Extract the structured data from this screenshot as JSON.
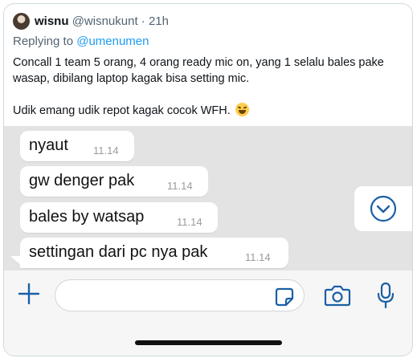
{
  "tweet": {
    "display_name": "wisnu",
    "handle": "@wisnukunt",
    "separator": " · ",
    "time": "21h",
    "replying_prefix": "Replying to ",
    "replying_to": "@umenumen",
    "paragraph_1": "Concall 1 team 5 orang, 4 orang ready mic on, yang 1 selalu bales pake wasap, dibilang laptop kagak bisa setting mic.",
    "paragraph_2": "Udik emang udik repot kagak cocok WFH.",
    "emoji": "face-with-tears-of-joy-icon"
  },
  "chat": {
    "background": "#e3e3e3",
    "messages": [
      {
        "text": "nyaut",
        "time": "11.14"
      },
      {
        "text": "gw denger pak",
        "time": "11.14"
      },
      {
        "text": "bales by watsap",
        "time": "11.14"
      },
      {
        "text": "settingan dari pc nya pak",
        "time": "11.14"
      }
    ]
  },
  "colors": {
    "accent": "#1d9bf0",
    "whatsapp_icon_blue": "#1a5fa6"
  },
  "icons": {
    "scroll_down": "chevron-down-circle-icon",
    "attach": "plus-icon",
    "sticker": "sticker-icon",
    "camera": "camera-icon",
    "microphone": "microphone-icon"
  }
}
